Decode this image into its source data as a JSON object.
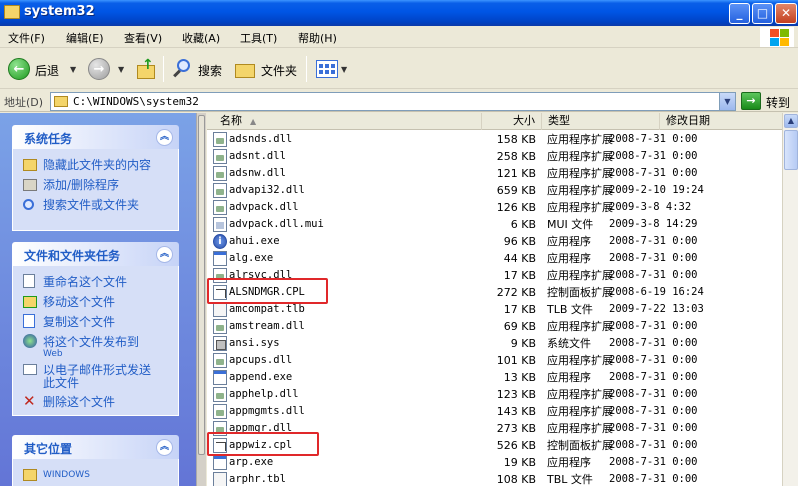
{
  "window": {
    "title": "system32"
  },
  "menu": [
    "文件(F)",
    "编辑(E)",
    "查看(V)",
    "收藏(A)",
    "工具(T)",
    "帮助(H)"
  ],
  "toolbar": {
    "back_label": "后退",
    "search_label": "搜索",
    "folders_label": "文件夹"
  },
  "address": {
    "label": "地址(D)",
    "value": "C:\\WINDOWS\\system32",
    "go_label": "转到"
  },
  "task_pane": {
    "system_tasks": {
      "title": "系统任务",
      "items": [
        "隐藏此文件夹的内容",
        "添加/删除程序",
        "搜索文件或文件夹"
      ]
    },
    "file_tasks": {
      "title": "文件和文件夹任务",
      "items": [
        "重命名这个文件",
        "移动这个文件",
        "复制这个文件",
        "将这个文件发布到",
        "Web",
        "以电子邮件形式发送",
        "此文件",
        "删除这个文件"
      ]
    },
    "other_places": {
      "title": "其它位置",
      "items": [
        "WINDOWS"
      ]
    }
  },
  "columns": {
    "name": "名称",
    "size": "大小",
    "type": "类型",
    "date": "修改日期"
  },
  "files": [
    {
      "name": "adsnds.dll",
      "size": "158 KB",
      "type": "应用程序扩展",
      "date": "2008-7-31 0:00",
      "icon": "dll"
    },
    {
      "name": "adsnt.dll",
      "size": "258 KB",
      "type": "应用程序扩展",
      "date": "2008-7-31 0:00",
      "icon": "dll"
    },
    {
      "name": "adsnw.dll",
      "size": "121 KB",
      "type": "应用程序扩展",
      "date": "2008-7-31 0:00",
      "icon": "dll"
    },
    {
      "name": "advapi32.dll",
      "size": "659 KB",
      "type": "应用程序扩展",
      "date": "2009-2-10 19:24",
      "icon": "dll"
    },
    {
      "name": "advpack.dll",
      "size": "126 KB",
      "type": "应用程序扩展",
      "date": "2009-3-8 4:32",
      "icon": "dll"
    },
    {
      "name": "advpack.dll.mui",
      "size": "6 KB",
      "type": "MUI 文件",
      "date": "2009-3-8 14:29",
      "icon": "mui"
    },
    {
      "name": "ahui.exe",
      "size": "96 KB",
      "type": "应用程序",
      "date": "2008-7-31 0:00",
      "icon": "info"
    },
    {
      "name": "alg.exe",
      "size": "44 KB",
      "type": "应用程序",
      "date": "2008-7-31 0:00",
      "icon": "exe"
    },
    {
      "name": "alrsvc.dll",
      "size": "17 KB",
      "type": "应用程序扩展",
      "date": "2008-7-31 0:00",
      "icon": "dll"
    },
    {
      "name": "ALSNDMGR.CPL",
      "size": "272 KB",
      "type": "控制面板扩展",
      "date": "2008-6-19 16:24",
      "icon": "cpl"
    },
    {
      "name": "amcompat.tlb",
      "size": "17 KB",
      "type": "TLB 文件",
      "date": "2009-7-22 13:03",
      "icon": "tlb"
    },
    {
      "name": "amstream.dll",
      "size": "69 KB",
      "type": "应用程序扩展",
      "date": "2008-7-31 0:00",
      "icon": "dll"
    },
    {
      "name": "ansi.sys",
      "size": "9 KB",
      "type": "系统文件",
      "date": "2008-7-31 0:00",
      "icon": "sys"
    },
    {
      "name": "apcups.dll",
      "size": "101 KB",
      "type": "应用程序扩展",
      "date": "2008-7-31 0:00",
      "icon": "dll"
    },
    {
      "name": "append.exe",
      "size": "13 KB",
      "type": "应用程序",
      "date": "2008-7-31 0:00",
      "icon": "exe"
    },
    {
      "name": "apphelp.dll",
      "size": "123 KB",
      "type": "应用程序扩展",
      "date": "2008-7-31 0:00",
      "icon": "dll"
    },
    {
      "name": "appmgmts.dll",
      "size": "143 KB",
      "type": "应用程序扩展",
      "date": "2008-7-31 0:00",
      "icon": "dll"
    },
    {
      "name": "appmgr.dll",
      "size": "273 KB",
      "type": "应用程序扩展",
      "date": "2008-7-31 0:00",
      "icon": "dll"
    },
    {
      "name": "appwiz.cpl",
      "size": "526 KB",
      "type": "控制面板扩展",
      "date": "2008-7-31 0:00",
      "icon": "cpl"
    },
    {
      "name": "arp.exe",
      "size": "19 KB",
      "type": "应用程序",
      "date": "2008-7-31 0:00",
      "icon": "exe"
    },
    {
      "name": "arphr.tbl",
      "size": "108 KB",
      "type": "TBL 文件",
      "date": "2008-7-31 0:00",
      "icon": "tlb"
    }
  ]
}
